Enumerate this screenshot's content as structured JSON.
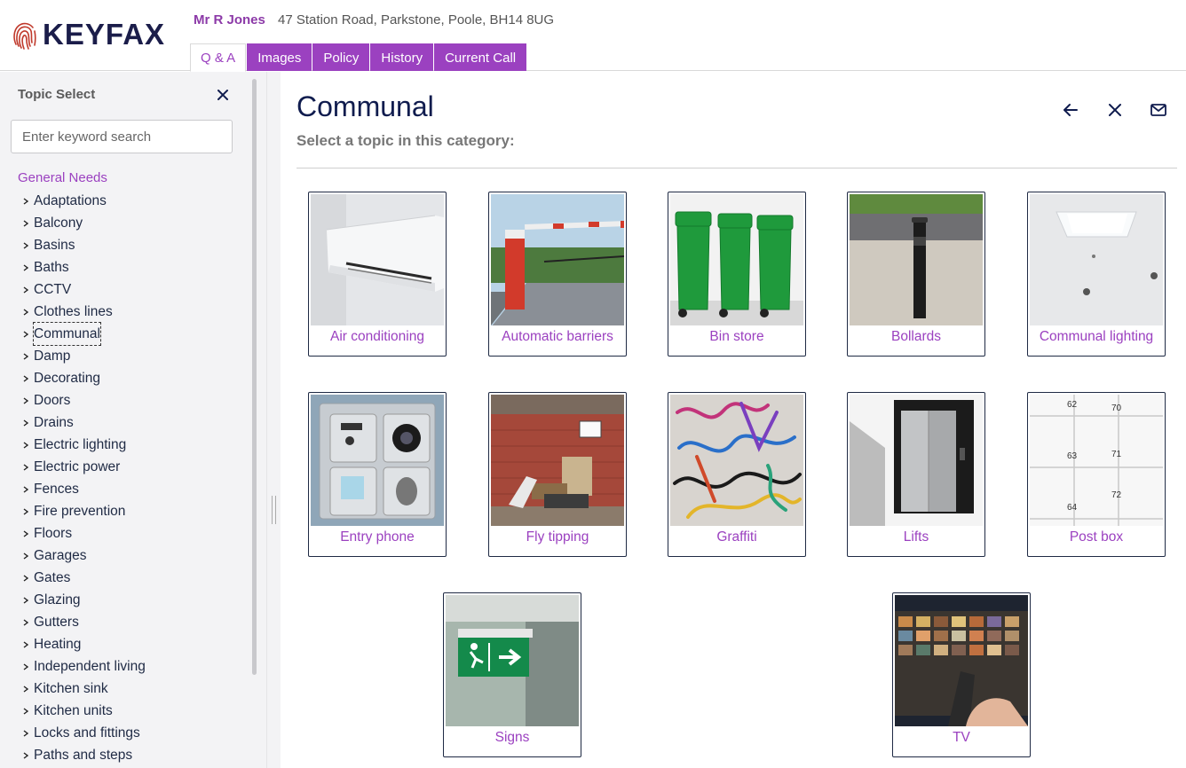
{
  "app": {
    "logo_text": "KEYFAX"
  },
  "caller": {
    "name": "Mr R Jones",
    "address": "47 Station Road, Parkstone, Poole, BH14 8UG"
  },
  "tabs": [
    {
      "label": "Q & A",
      "active": true
    },
    {
      "label": "Images",
      "active": false
    },
    {
      "label": "Policy",
      "active": false
    },
    {
      "label": "History",
      "active": false
    },
    {
      "label": "Current Call",
      "active": false
    }
  ],
  "sidebar": {
    "title": "Topic Select",
    "search_placeholder": "Enter keyword search",
    "category": "General Needs",
    "items": [
      "Adaptations",
      "Balcony",
      "Basins",
      "Baths",
      "CCTV",
      "Clothes lines",
      "Communal",
      "Damp",
      "Decorating",
      "Doors",
      "Drains",
      "Electric lighting",
      "Electric power",
      "Fences",
      "Fire prevention",
      "Floors",
      "Garages",
      "Gates",
      "Glazing",
      "Gutters",
      "Heating",
      "Independent living",
      "Kitchen sink",
      "Kitchen units",
      "Locks and fittings",
      "Paths and steps"
    ],
    "active_item": "Communal"
  },
  "main": {
    "title": "Communal",
    "subtitle": "Select a topic in this category:",
    "topics": [
      {
        "label": "Air conditioning",
        "icon": "air-conditioner-image"
      },
      {
        "label": "Automatic barriers",
        "icon": "barrier-image"
      },
      {
        "label": "Bin store",
        "icon": "bins-image"
      },
      {
        "label": "Bollards",
        "icon": "bollard-image"
      },
      {
        "label": "Communal lighting",
        "icon": "ceiling-light-image"
      },
      {
        "label": "Entry phone",
        "icon": "intercom-image"
      },
      {
        "label": "Fly tipping",
        "icon": "fly-tipping-image"
      },
      {
        "label": "Graffiti",
        "icon": "graffiti-image"
      },
      {
        "label": "Lifts",
        "icon": "lift-image"
      },
      {
        "label": "Post box",
        "icon": "mailbox-image"
      },
      {
        "label": "Signs",
        "icon": "exit-sign-image"
      },
      {
        "label": "TV",
        "icon": "tv-image"
      }
    ]
  },
  "colors": {
    "brand_purple": "#9b41c0",
    "navy": "#101c4e",
    "sidebar_bg": "#f3f3f5"
  }
}
